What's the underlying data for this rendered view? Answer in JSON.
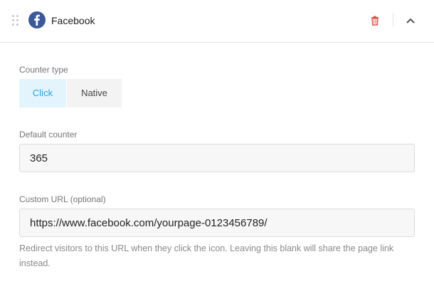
{
  "header": {
    "network_name": "Facebook",
    "network_icon": "facebook-icon",
    "brand_color": "#3b5998",
    "delete_icon": "trash-icon",
    "delete_color": "#e2504f",
    "collapse_icon": "chevron-up-icon"
  },
  "counter_type": {
    "label": "Counter type",
    "options": [
      "Click",
      "Native"
    ],
    "selected": "Click",
    "accent_color": "#2ea0d8"
  },
  "default_counter": {
    "label": "Default counter",
    "value": "365"
  },
  "custom_url": {
    "label": "Custom URL (optional)",
    "value": "https://www.facebook.com/yourpage-0123456789/",
    "help": "Redirect visitors to this URL when they click the icon. Leaving this blank will share the page link instead."
  }
}
